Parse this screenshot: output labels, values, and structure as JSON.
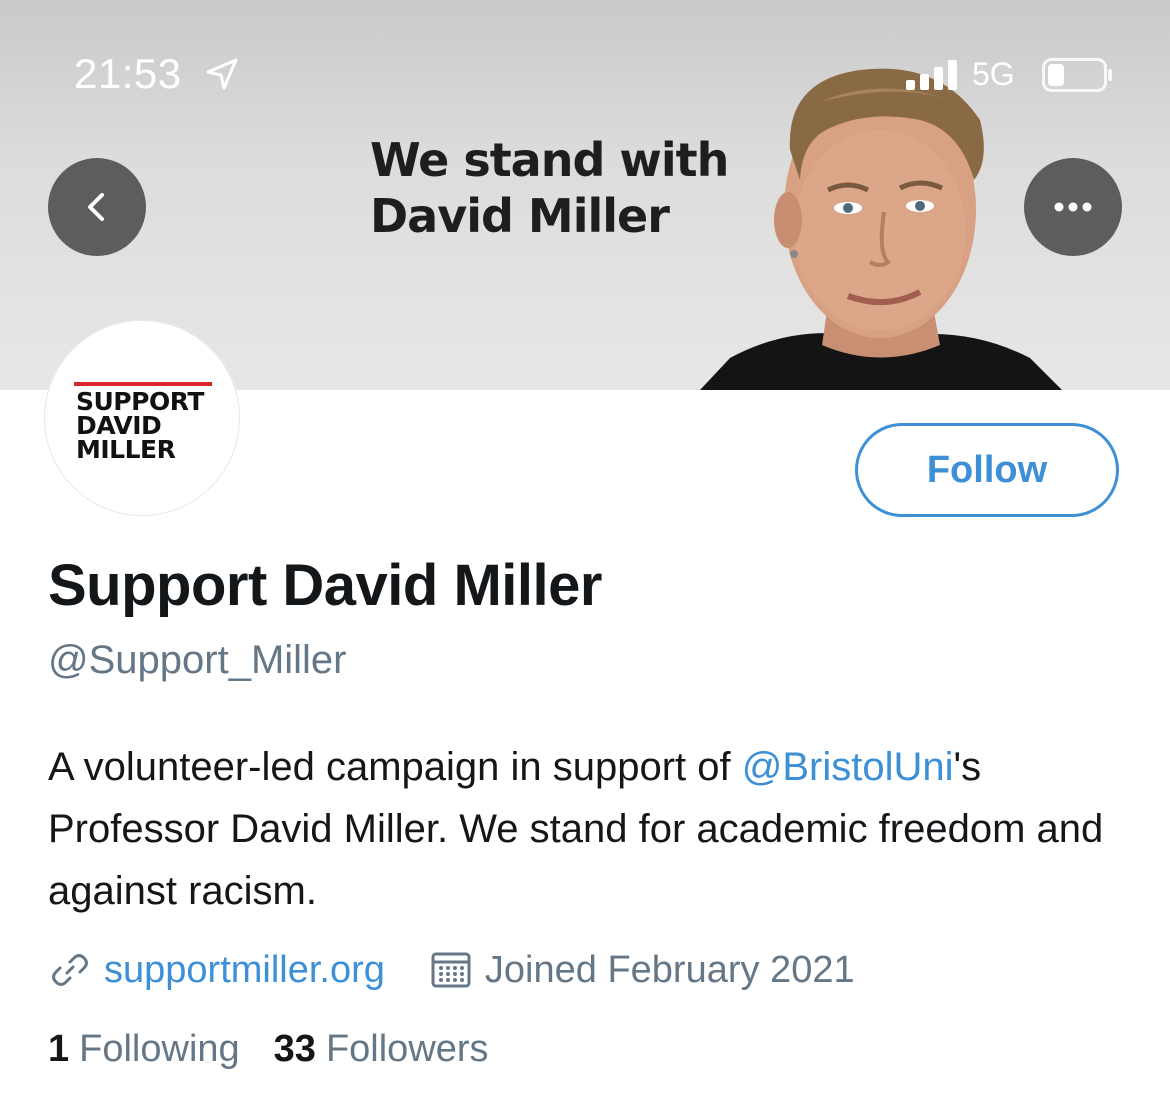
{
  "status_bar": {
    "time": "21:53",
    "network": "5G",
    "icons": [
      "location-arrow-icon",
      "signal-bars-icon",
      "battery-icon"
    ]
  },
  "banner": {
    "line1": "We stand with",
    "line2": "David Miller"
  },
  "avatar": {
    "line1": "SUPPORT",
    "line2": "DAVID",
    "line3": "MILLER",
    "accent_color": "#d7262c"
  },
  "actions": {
    "follow_label": "Follow"
  },
  "profile": {
    "display_name": "Support David Miller",
    "handle": "@Support_Miller",
    "bio_part1": "A volunteer-led campaign in support of ",
    "bio_mention": "@BristolUni",
    "bio_part2": "'s Professor David Miller. We stand for academic freedom and against racism.",
    "website": "supportmiller.org",
    "joined": "Joined February 2021"
  },
  "stats": {
    "following_count": "1",
    "following_label": "Following",
    "followers_count": "33",
    "followers_label": "Followers"
  },
  "colors": {
    "link_blue": "#3d8fd6",
    "secondary_text": "#657786",
    "primary_text": "#14171a"
  }
}
